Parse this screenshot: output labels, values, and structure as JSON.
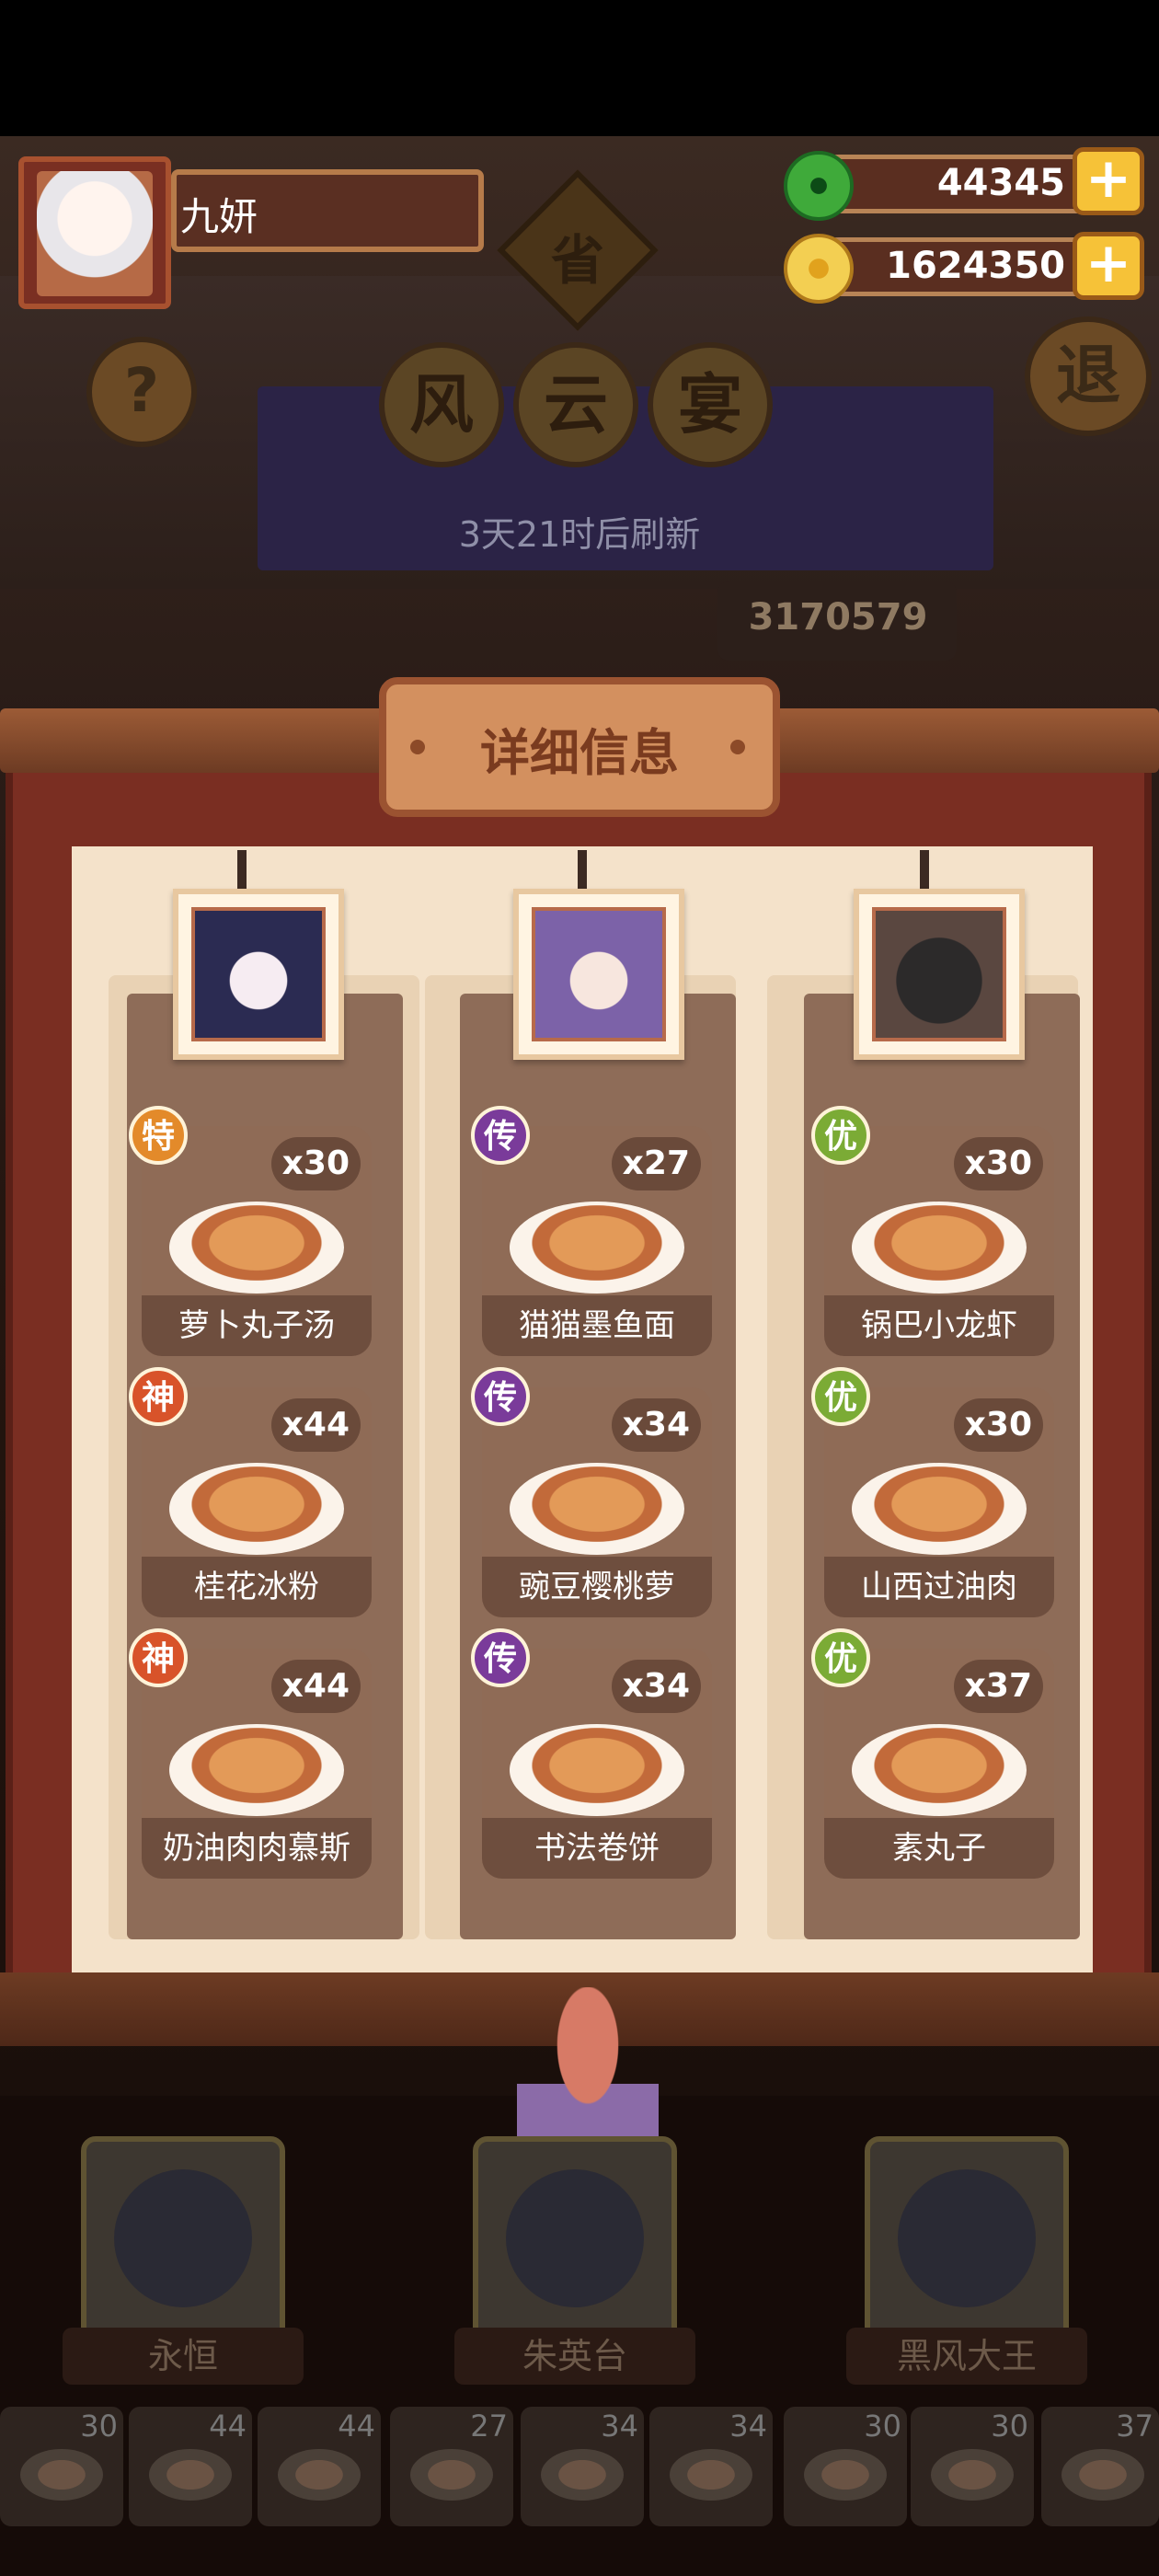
{
  "header": {
    "player_name": "九妍",
    "jade_amount": "44345",
    "gold_amount": "1624350",
    "plus_glyph": "+",
    "help_glyph": "?",
    "exit_label": "退",
    "province_label": "省",
    "event_title_chars": [
      "风",
      "云",
      "宴"
    ],
    "refresh_text": "3天21时后刷新",
    "score_text": "3170579"
  },
  "panel": {
    "title": "详细信息",
    "columns": [
      {
        "portrait": "avatar-yongheng",
        "dishes": [
          {
            "badge": "特",
            "badge_color": "#e38a2a",
            "qty": "x30",
            "name": "萝卜丸子汤"
          },
          {
            "badge": "神",
            "badge_color": "#d8532a",
            "qty": "x44",
            "name": "桂花冰粉"
          },
          {
            "badge": "神",
            "badge_color": "#d8532a",
            "qty": "x44",
            "name": "奶油肉肉慕斯"
          }
        ]
      },
      {
        "portrait": "avatar-zhuyingtai",
        "dishes": [
          {
            "badge": "传",
            "badge_color": "#7a3b9a",
            "qty": "x27",
            "name": "猫猫墨鱼面"
          },
          {
            "badge": "传",
            "badge_color": "#7a3b9a",
            "qty": "x34",
            "name": "豌豆樱桃萝"
          },
          {
            "badge": "传",
            "badge_color": "#7a3b9a",
            "qty": "x34",
            "name": "书法卷饼"
          }
        ]
      },
      {
        "portrait": "avatar-heifengdawang",
        "dishes": [
          {
            "badge": "优",
            "badge_color": "#7bab35",
            "qty": "x30",
            "name": "锅巴小龙虾"
          },
          {
            "badge": "优",
            "badge_color": "#7bab35",
            "qty": "x30",
            "name": "山西过油肉"
          },
          {
            "badge": "优",
            "badge_color": "#7bab35",
            "qty": "x37",
            "name": "素丸子"
          }
        ]
      }
    ]
  },
  "bottom": {
    "chefs": [
      {
        "name": "永恒"
      },
      {
        "name": "朱英台"
      },
      {
        "name": "黑风大王"
      }
    ],
    "slots": [
      "30",
      "44",
      "44",
      "27",
      "34",
      "34",
      "30",
      "30",
      "37"
    ]
  }
}
